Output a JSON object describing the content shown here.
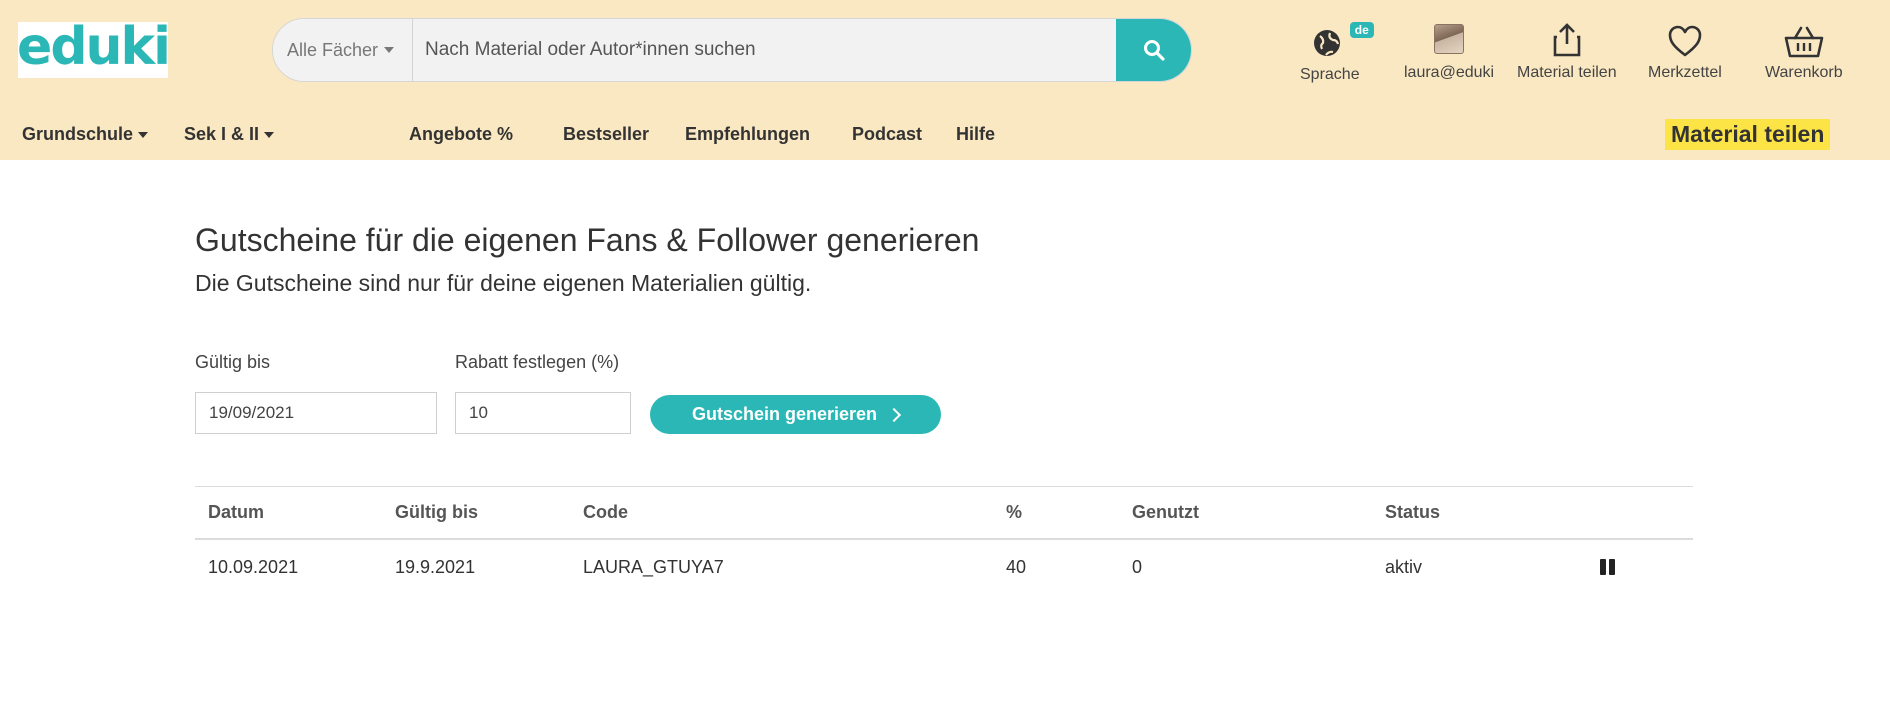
{
  "header": {
    "logo": "eduki",
    "search": {
      "category": "Alle Fächer",
      "placeholder": "Nach Material oder Autor*innen suchen"
    },
    "icons": {
      "language_label": "Sprache",
      "language_badge": "de",
      "user_label": "laura@eduki",
      "share_label": "Material teilen",
      "wishlist_label": "Merkzettel",
      "cart_label": "Warenkorb"
    },
    "nav": {
      "grundschule": "Grundschule",
      "sek": "Sek I & II",
      "angebote": "Angebote %",
      "bestseller": "Bestseller",
      "empfehlungen": "Empfehlungen",
      "podcast": "Podcast",
      "hilfe": "Hilfe",
      "material_teilen": "Material teilen"
    }
  },
  "main": {
    "title": "Gutscheine für die eigenen Fans & Follower generieren",
    "subtitle": "Die Gutscheine sind nur für deine eigenen Materialien gültig.",
    "form": {
      "valid_until_label": "Gültig bis",
      "valid_until_value": "19/09/2021",
      "discount_label": "Rabatt festlegen (%)",
      "discount_value": "10",
      "generate_button": "Gutschein generieren"
    },
    "table": {
      "headers": {
        "date": "Datum",
        "valid_until": "Gültig bis",
        "code": "Code",
        "percent": "%",
        "used": "Genutzt",
        "status": "Status"
      },
      "rows": [
        {
          "date": "10.09.2021",
          "valid_until": "19.9.2021",
          "code": "LAURA_GTUYA7",
          "percent": "40",
          "used": "0",
          "status": "aktiv"
        }
      ]
    }
  },
  "colors": {
    "header_bg": "#f9e8c2",
    "accent": "#2ab7b5",
    "highlight": "#fde446"
  }
}
